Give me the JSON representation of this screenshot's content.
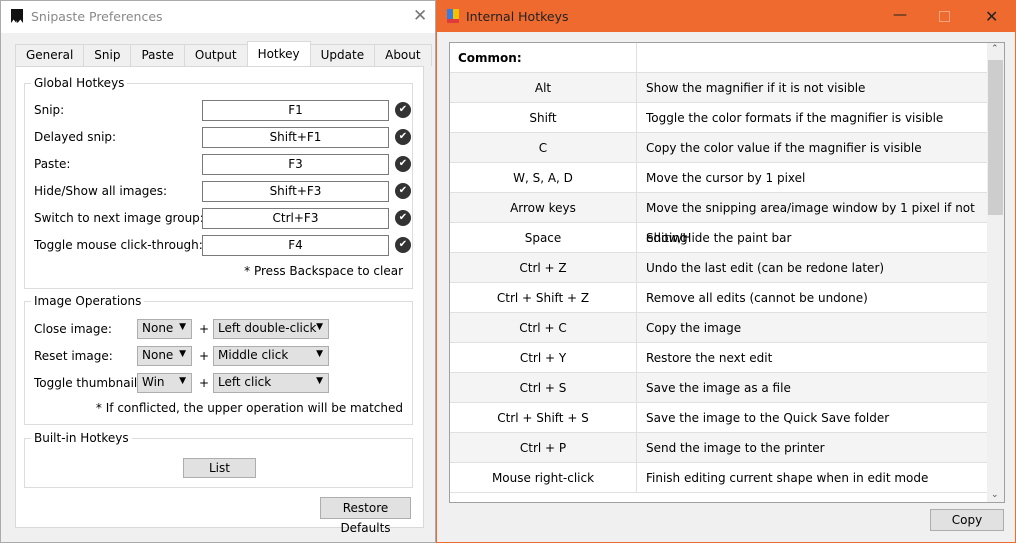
{
  "prefs": {
    "title": "Snipaste Preferences",
    "tabs": [
      "General",
      "Snip",
      "Paste",
      "Output",
      "Hotkey",
      "Update",
      "About"
    ],
    "active_tab": "Hotkey",
    "global": {
      "title": "Global Hotkeys",
      "items": [
        {
          "label": "Snip:",
          "value": "F1"
        },
        {
          "label": "Delayed snip:",
          "value": "Shift+F1"
        },
        {
          "label": "Paste:",
          "value": "F3"
        },
        {
          "label": "Hide/Show all images:",
          "value": "Shift+F3"
        },
        {
          "label": "Switch to next image group:",
          "value": "Ctrl+F3"
        },
        {
          "label": "Toggle mouse click-through:",
          "value": "F4"
        }
      ],
      "note": "* Press Backspace to clear"
    },
    "imageops": {
      "title": "Image Operations",
      "items": [
        {
          "label": "Close image:",
          "mod": "None",
          "action": "Left double-click"
        },
        {
          "label": "Reset image:",
          "mod": "None",
          "action": "Middle click"
        },
        {
          "label": "Toggle thumbnail:",
          "mod": "Win",
          "action": "Left click"
        }
      ],
      "plus": "+",
      "note": "* If conflicted, the upper operation will be matched"
    },
    "builtin": {
      "title": "Built-in Hotkeys",
      "list_label": "List"
    },
    "restore_label": "Restore Defaults"
  },
  "hotkeys": {
    "title": "Internal Hotkeys",
    "header": "Common:",
    "rows": [
      [
        "Alt",
        "Show the magnifier if it is not visible"
      ],
      [
        "Shift",
        "Toggle the color formats if the magnifier is visible"
      ],
      [
        "C",
        "Copy the color value if the magnifier is visible"
      ],
      [
        "W, S, A, D",
        "Move the cursor by 1 pixel"
      ],
      [
        "Arrow keys",
        "Move the snipping area/image window by 1 pixel if not editing"
      ],
      [
        "Space",
        "Show/Hide the paint bar"
      ],
      [
        "Ctrl + Z",
        "Undo the last edit (can be redone later)"
      ],
      [
        "Ctrl + Shift + Z",
        "Remove all edits (cannot be undone)"
      ],
      [
        "Ctrl + C",
        "Copy the image"
      ],
      [
        "Ctrl + Y",
        "Restore the next edit"
      ],
      [
        "Ctrl + S",
        "Save the image as a file"
      ],
      [
        "Ctrl + Shift + S",
        "Save the image to the Quick Save folder"
      ],
      [
        "Ctrl + P",
        "Send the image to the printer"
      ],
      [
        "Mouse right-click",
        "Finish editing current shape when in edit mode"
      ]
    ],
    "copy_label": "Copy",
    "accent": "#ee6a2f"
  }
}
